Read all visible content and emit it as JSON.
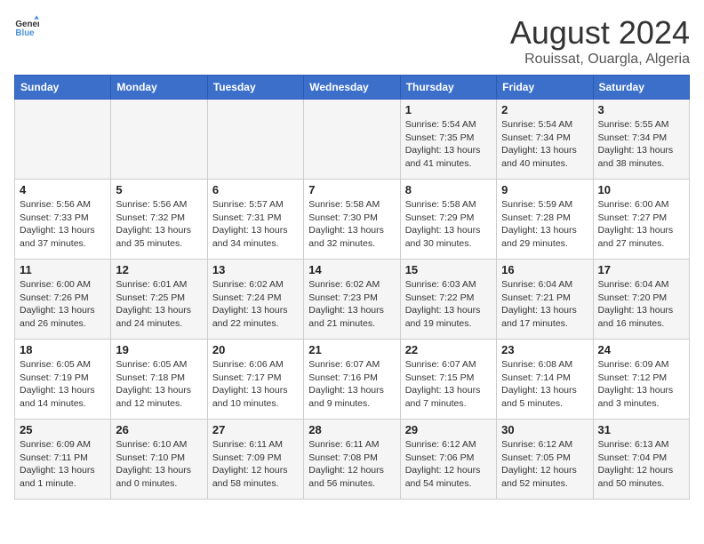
{
  "header": {
    "logo_line1": "General",
    "logo_line2": "Blue",
    "main_title": "August 2024",
    "subtitle": "Rouissat, Ouargla, Algeria"
  },
  "weekdays": [
    "Sunday",
    "Monday",
    "Tuesday",
    "Wednesday",
    "Thursday",
    "Friday",
    "Saturday"
  ],
  "weeks": [
    [
      {
        "day": "",
        "info": ""
      },
      {
        "day": "",
        "info": ""
      },
      {
        "day": "",
        "info": ""
      },
      {
        "day": "",
        "info": ""
      },
      {
        "day": "1",
        "info": "Sunrise: 5:54 AM\nSunset: 7:35 PM\nDaylight: 13 hours\nand 41 minutes."
      },
      {
        "day": "2",
        "info": "Sunrise: 5:54 AM\nSunset: 7:34 PM\nDaylight: 13 hours\nand 40 minutes."
      },
      {
        "day": "3",
        "info": "Sunrise: 5:55 AM\nSunset: 7:34 PM\nDaylight: 13 hours\nand 38 minutes."
      }
    ],
    [
      {
        "day": "4",
        "info": "Sunrise: 5:56 AM\nSunset: 7:33 PM\nDaylight: 13 hours\nand 37 minutes."
      },
      {
        "day": "5",
        "info": "Sunrise: 5:56 AM\nSunset: 7:32 PM\nDaylight: 13 hours\nand 35 minutes."
      },
      {
        "day": "6",
        "info": "Sunrise: 5:57 AM\nSunset: 7:31 PM\nDaylight: 13 hours\nand 34 minutes."
      },
      {
        "day": "7",
        "info": "Sunrise: 5:58 AM\nSunset: 7:30 PM\nDaylight: 13 hours\nand 32 minutes."
      },
      {
        "day": "8",
        "info": "Sunrise: 5:58 AM\nSunset: 7:29 PM\nDaylight: 13 hours\nand 30 minutes."
      },
      {
        "day": "9",
        "info": "Sunrise: 5:59 AM\nSunset: 7:28 PM\nDaylight: 13 hours\nand 29 minutes."
      },
      {
        "day": "10",
        "info": "Sunrise: 6:00 AM\nSunset: 7:27 PM\nDaylight: 13 hours\nand 27 minutes."
      }
    ],
    [
      {
        "day": "11",
        "info": "Sunrise: 6:00 AM\nSunset: 7:26 PM\nDaylight: 13 hours\nand 26 minutes."
      },
      {
        "day": "12",
        "info": "Sunrise: 6:01 AM\nSunset: 7:25 PM\nDaylight: 13 hours\nand 24 minutes."
      },
      {
        "day": "13",
        "info": "Sunrise: 6:02 AM\nSunset: 7:24 PM\nDaylight: 13 hours\nand 22 minutes."
      },
      {
        "day": "14",
        "info": "Sunrise: 6:02 AM\nSunset: 7:23 PM\nDaylight: 13 hours\nand 21 minutes."
      },
      {
        "day": "15",
        "info": "Sunrise: 6:03 AM\nSunset: 7:22 PM\nDaylight: 13 hours\nand 19 minutes."
      },
      {
        "day": "16",
        "info": "Sunrise: 6:04 AM\nSunset: 7:21 PM\nDaylight: 13 hours\nand 17 minutes."
      },
      {
        "day": "17",
        "info": "Sunrise: 6:04 AM\nSunset: 7:20 PM\nDaylight: 13 hours\nand 16 minutes."
      }
    ],
    [
      {
        "day": "18",
        "info": "Sunrise: 6:05 AM\nSunset: 7:19 PM\nDaylight: 13 hours\nand 14 minutes."
      },
      {
        "day": "19",
        "info": "Sunrise: 6:05 AM\nSunset: 7:18 PM\nDaylight: 13 hours\nand 12 minutes."
      },
      {
        "day": "20",
        "info": "Sunrise: 6:06 AM\nSunset: 7:17 PM\nDaylight: 13 hours\nand 10 minutes."
      },
      {
        "day": "21",
        "info": "Sunrise: 6:07 AM\nSunset: 7:16 PM\nDaylight: 13 hours\nand 9 minutes."
      },
      {
        "day": "22",
        "info": "Sunrise: 6:07 AM\nSunset: 7:15 PM\nDaylight: 13 hours\nand 7 minutes."
      },
      {
        "day": "23",
        "info": "Sunrise: 6:08 AM\nSunset: 7:14 PM\nDaylight: 13 hours\nand 5 minutes."
      },
      {
        "day": "24",
        "info": "Sunrise: 6:09 AM\nSunset: 7:12 PM\nDaylight: 13 hours\nand 3 minutes."
      }
    ],
    [
      {
        "day": "25",
        "info": "Sunrise: 6:09 AM\nSunset: 7:11 PM\nDaylight: 13 hours\nand 1 minute."
      },
      {
        "day": "26",
        "info": "Sunrise: 6:10 AM\nSunset: 7:10 PM\nDaylight: 13 hours\nand 0 minutes."
      },
      {
        "day": "27",
        "info": "Sunrise: 6:11 AM\nSunset: 7:09 PM\nDaylight: 12 hours\nand 58 minutes."
      },
      {
        "day": "28",
        "info": "Sunrise: 6:11 AM\nSunset: 7:08 PM\nDaylight: 12 hours\nand 56 minutes."
      },
      {
        "day": "29",
        "info": "Sunrise: 6:12 AM\nSunset: 7:06 PM\nDaylight: 12 hours\nand 54 minutes."
      },
      {
        "day": "30",
        "info": "Sunrise: 6:12 AM\nSunset: 7:05 PM\nDaylight: 12 hours\nand 52 minutes."
      },
      {
        "day": "31",
        "info": "Sunrise: 6:13 AM\nSunset: 7:04 PM\nDaylight: 12 hours\nand 50 minutes."
      }
    ]
  ]
}
